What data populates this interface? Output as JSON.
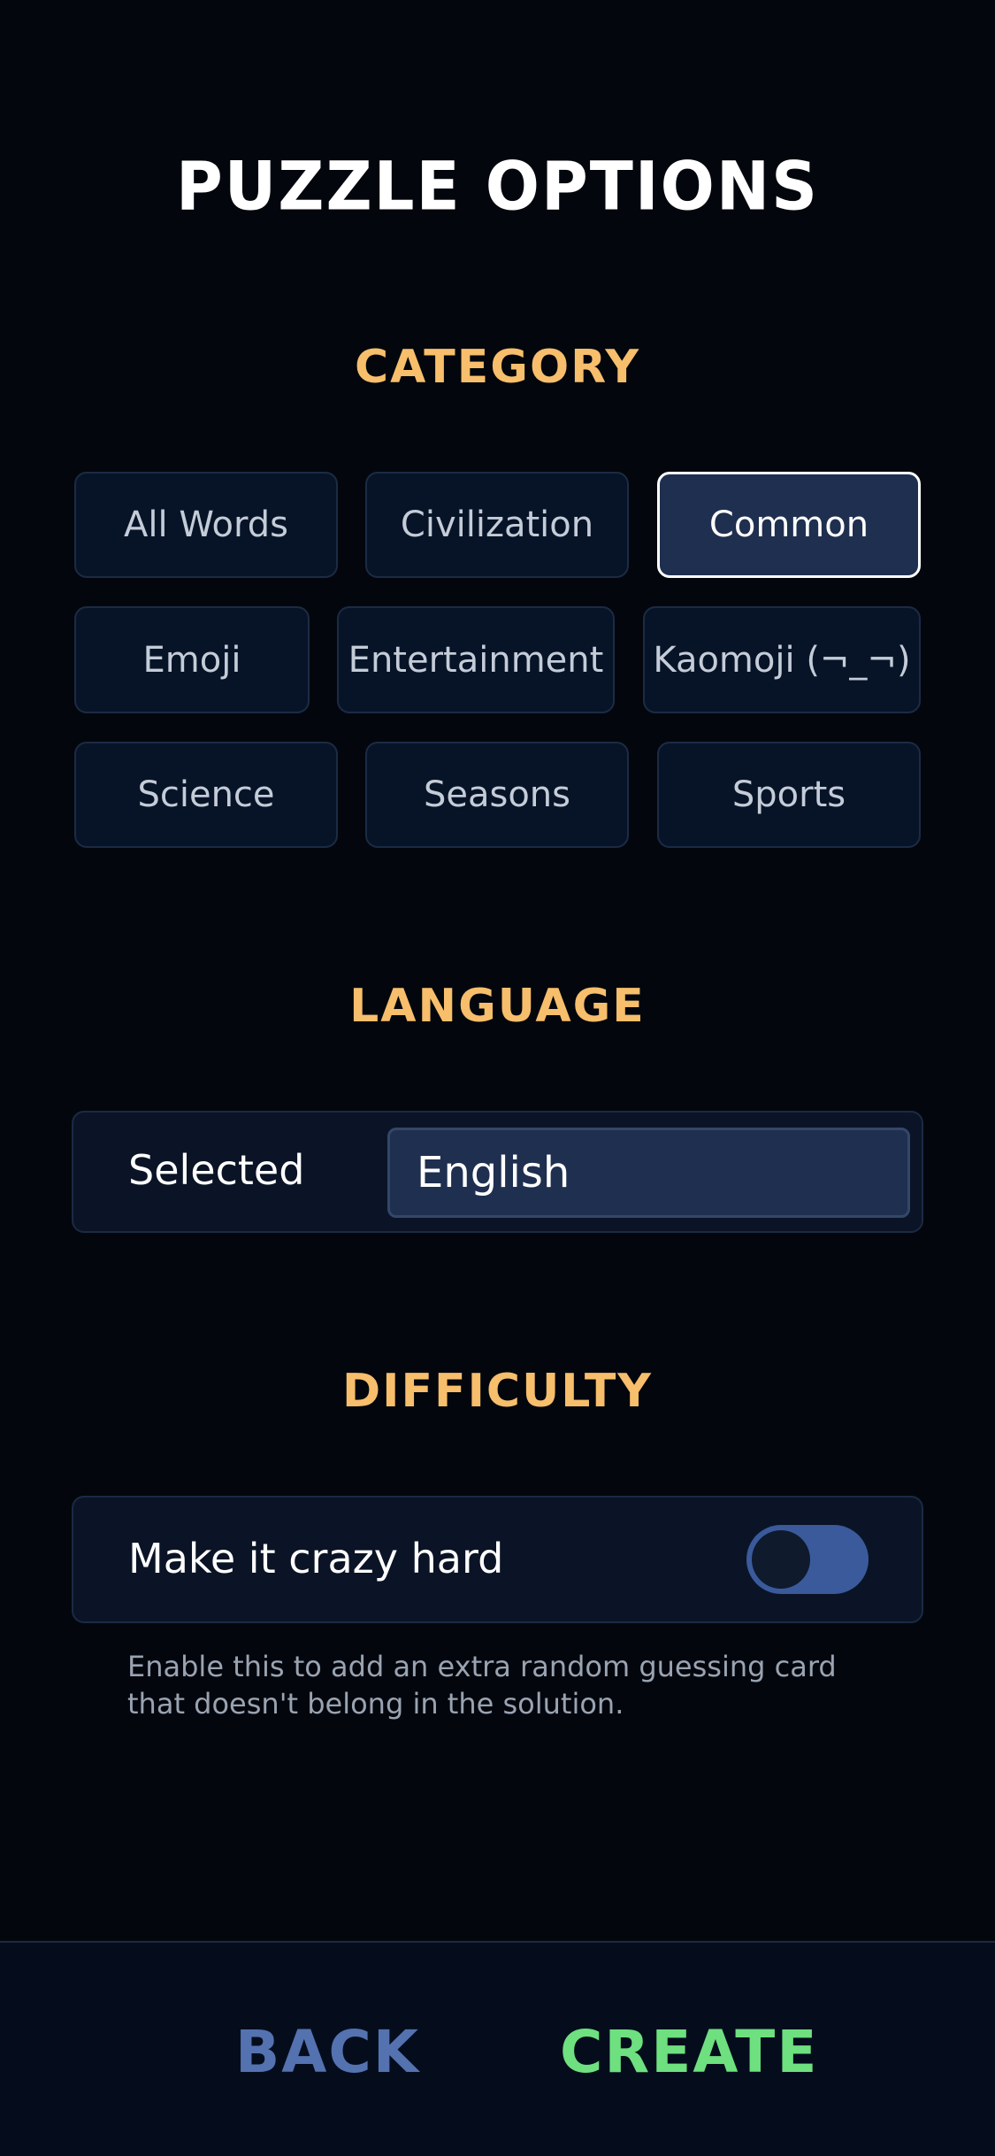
{
  "title": "PUZZLE OPTIONS",
  "category": {
    "heading": "CATEGORY",
    "options": [
      {
        "label": "All Words"
      },
      {
        "label": "Civilization"
      },
      {
        "label": "Common",
        "selected": true
      },
      {
        "label": "Emoji"
      },
      {
        "label": "Entertainment"
      },
      {
        "label": "Kaomoji (¬_¬)"
      },
      {
        "label": "Science"
      },
      {
        "label": "Seasons"
      },
      {
        "label": "Sports"
      }
    ]
  },
  "language": {
    "heading": "LANGUAGE",
    "label": "Selected",
    "value": "English"
  },
  "difficulty": {
    "heading": "DIFFICULTY",
    "toggle_label": "Make it crazy hard",
    "toggle_on": false,
    "helper": "Enable this to add an extra random guessing card that doesn't belong in the solution."
  },
  "footer": {
    "back_label": "BACK",
    "create_label": "CREATE"
  },
  "colors": {
    "background": "#03070d",
    "heading_accent": "#f7be6c",
    "back": "#5472b0",
    "create": "#6ee07f",
    "toggle_track": "#3a5a9c"
  }
}
